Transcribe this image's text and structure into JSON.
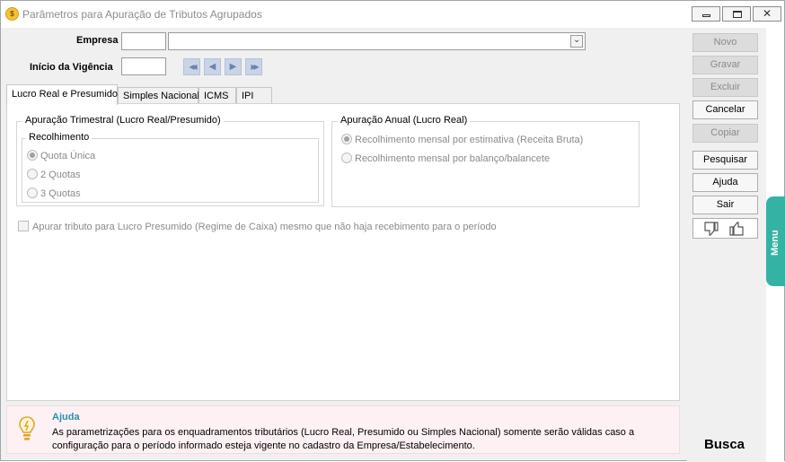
{
  "window": {
    "title": "Parâmetros para Apuração de Tributos Agrupados",
    "minimize_glyph": "",
    "close_glyph": "✕"
  },
  "form": {
    "empresa_label": "Empresa",
    "empresa_code": "",
    "empresa_name": "",
    "vigencia_label": "Início da Vigência",
    "vigencia_value": ""
  },
  "nav": {
    "first": "◀◀",
    "prev": "◀",
    "next": "▶",
    "last": "▶▶"
  },
  "tabs": [
    {
      "label": "Lucro Real e Presumido",
      "active": true
    },
    {
      "label": "Simples Nacional"
    },
    {
      "label": "ICMS"
    },
    {
      "label": "IPI"
    }
  ],
  "trimestral": {
    "title": "Apuração Trimestral (Lucro Real/Presumido)",
    "recolhimento_title": "Recolhimento",
    "options": [
      "Quota Única",
      "2 Quotas",
      "3 Quotas"
    ]
  },
  "anual": {
    "title": "Apuração Anual (Lucro Real)",
    "options": [
      "Recolhimento mensal por estimativa (Receita Bruta)",
      "Recolhimento mensal por balanço/balancete"
    ]
  },
  "checkbox_caixa": "Apurar tributo para Lucro Presumido (Regime de Caixa) mesmo que não haja recebimento para o período",
  "help": {
    "title": "Ajuda",
    "text": "As parametrizações para os enquadramentos tributários (Lucro Real, Presumido ou Simples Nacional) somente serão válidas caso a configuração para o período informado esteja vigente no cadastro da Empresa/Estabelecimento."
  },
  "sidebar": {
    "novo": "Novo",
    "gravar": "Gravar",
    "excluir": "Excluir",
    "cancelar": "Cancelar",
    "copiar": "Copiar",
    "pesquisar": "Pesquisar",
    "ajuda": "Ajuda",
    "sair": "Sair",
    "busca": "Busca"
  },
  "menu_tab": "Menu",
  "colors": {
    "accent_teal": "#34b3a5",
    "help_title": "#2b8fb5",
    "help_bg": "#fdf1f4"
  }
}
